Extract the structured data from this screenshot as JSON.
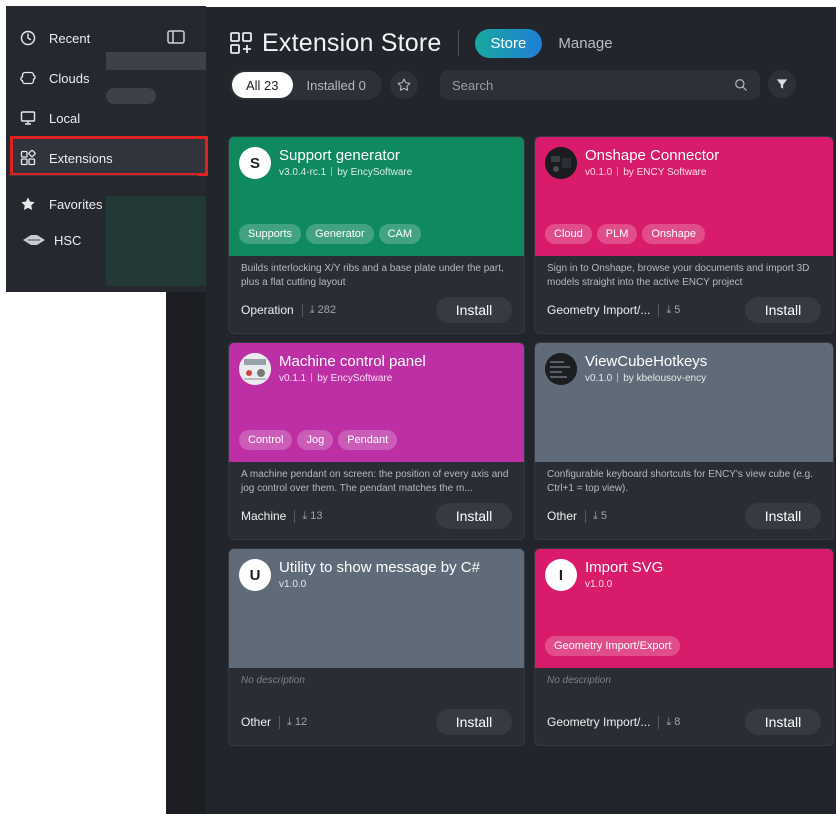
{
  "sidebar": {
    "items": [
      {
        "label": "Recent",
        "icon": "clock-icon"
      },
      {
        "label": "Clouds",
        "icon": "cloud-icon"
      },
      {
        "label": "Local",
        "icon": "monitor-icon"
      },
      {
        "label": "Extensions",
        "icon": "extensions-icon",
        "selected": true
      },
      {
        "label": "Favorites",
        "icon": "star-icon"
      },
      {
        "label": "HSC",
        "icon": "hsc-icon"
      }
    ]
  },
  "header": {
    "title": "Extension Store",
    "store_tab": "Store",
    "manage_tab": "Manage"
  },
  "filters": {
    "all_label": "All 23",
    "installed_label": "Installed 0",
    "search_placeholder": "Search"
  },
  "cards": [
    {
      "name": "Support generator",
      "version": "v3.0.4-rc.1",
      "author": "by EncySoftware",
      "avatar": "S",
      "tags": [
        "Supports",
        "Generator",
        "CAM"
      ],
      "description": "Builds interlocking X/Y ribs and a base plate under the part, plus a flat cutting layout",
      "category": "Operation",
      "downloads": "282",
      "install": "Install",
      "color": "#0f8a5e"
    },
    {
      "name": "Onshape Connector",
      "version": "v0.1.0",
      "author": "by ENCY Software",
      "avatar": "",
      "tags": [
        "Cloud",
        "PLM",
        "Onshape"
      ],
      "description": "Sign in to Onshape, browse your documents and import 3D models straight into the active ENCY project",
      "category": "Geometry Import/...",
      "downloads": "5",
      "install": "Install",
      "color": "#d81b6a"
    },
    {
      "name": "Machine control panel",
      "version": "v0.1.1",
      "author": "by EncySoftware",
      "avatar": "",
      "tags": [
        "Control",
        "Jog",
        "Pendant"
      ],
      "description": "A machine pendant on screen: the position of every axis and jog control over them. The pendant matches the m...",
      "category": "Machine",
      "downloads": "13",
      "install": "Install",
      "color": "#bd2fa4"
    },
    {
      "name": "ViewCubeHotkeys",
      "version": "v0.1.0",
      "author": "by kbelousov-ency",
      "avatar": "",
      "tags": [],
      "description": "Configurable keyboard shortcuts for ENCY's view cube (e.g. Ctrl+1 = top view).",
      "category": "Other",
      "downloads": "5",
      "install": "Install",
      "color": "#5f6b78"
    },
    {
      "name": "Utility to show message by C#",
      "version": "v1.0.0",
      "author": "",
      "avatar": "U",
      "tags": [],
      "description": "No description",
      "category": "Other",
      "downloads": "12",
      "install": "Install",
      "color": "#5f6b78"
    },
    {
      "name": "Import SVG",
      "version": "v1.0.0",
      "author": "",
      "avatar": "I",
      "tags": [
        "Geometry Import/Export"
      ],
      "description": "No description",
      "category": "Geometry Import/...",
      "downloads": "8",
      "install": "Install",
      "color": "#d81b6a"
    }
  ]
}
